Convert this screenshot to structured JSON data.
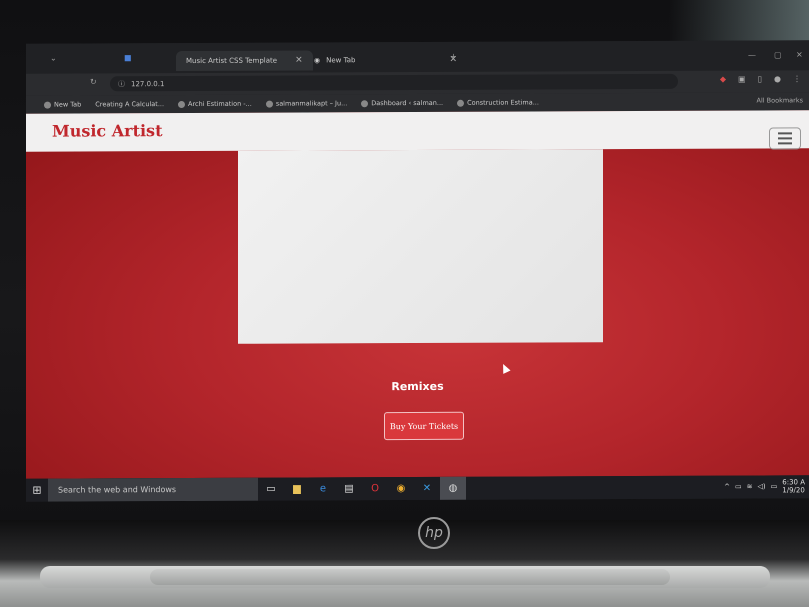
{
  "browser": {
    "tabs": [
      {
        "title": "Music Artist CSS Template",
        "active": true
      },
      {
        "title": "New Tab",
        "active": false
      }
    ],
    "new_tab_symbol": "+",
    "address": "127.0.0.1",
    "bookmarks": [
      "New Tab",
      "Creating A Calculat...",
      "Archi Estimation -...",
      "salmanmalikapt – Ju...",
      "Dashboard ‹ salman...",
      "Construction Estima..."
    ],
    "all_bookmarks": "All Bookmarks"
  },
  "page": {
    "brand": "Music Artist",
    "section_title": "Remixes",
    "cta_label": "Buy Your Tickets",
    "accent": "#c0272d"
  },
  "taskbar": {
    "search_placeholder": "Search the web and Windows",
    "time": "6:30 A",
    "date": "1/9/20"
  },
  "device": {
    "logo": "hp"
  }
}
